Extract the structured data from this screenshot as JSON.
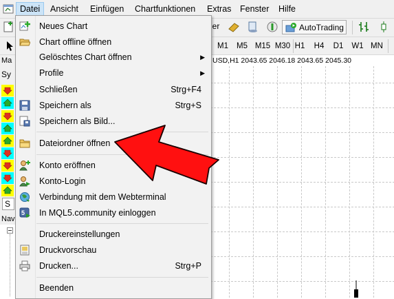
{
  "menubar": {
    "items": [
      "Datei",
      "Ansicht",
      "Einfügen",
      "Chartfunktionen",
      "Extras",
      "Fenster",
      "Hilfe"
    ]
  },
  "toolbar": {
    "autotrading_label": "AutoTrading"
  },
  "timeframes": [
    "M1",
    "M5",
    "M15",
    "M30",
    "H1",
    "H4",
    "D1",
    "W1",
    "MN"
  ],
  "left_panel": {
    "market_label": "Ma",
    "symbols_label": "Sy",
    "symbols_tab": "S",
    "navigator_label": "Nav"
  },
  "chart": {
    "title": "USD,H1  2043.65 2046.18 2043.65 2045.30"
  },
  "file_menu": {
    "items": [
      {
        "label": "Neues Chart",
        "shortcut": "",
        "submenu": false,
        "icon": "new-chart-icon"
      },
      {
        "label": "Chart offline öffnen",
        "shortcut": "",
        "submenu": false,
        "icon": "folder-open-icon"
      },
      {
        "label": "Gelöschtes Chart öffnen",
        "shortcut": "",
        "submenu": true,
        "icon": ""
      },
      {
        "label": "Profile",
        "shortcut": "",
        "submenu": true,
        "icon": ""
      },
      {
        "label": "Schließen",
        "shortcut": "Strg+F4",
        "submenu": false,
        "icon": ""
      },
      {
        "label": "Speichern als",
        "shortcut": "Strg+S",
        "submenu": false,
        "icon": "save-icon"
      },
      {
        "label": "Speichern als Bild...",
        "shortcut": "",
        "submenu": false,
        "icon": "save-image-icon"
      },
      {
        "label": "Dateiordner öffnen",
        "shortcut": "",
        "submenu": false,
        "icon": "folder-icon"
      },
      {
        "label": "Konto eröffnen",
        "shortcut": "",
        "submenu": false,
        "icon": "open-account-icon"
      },
      {
        "label": "Konto-Login",
        "shortcut": "",
        "submenu": false,
        "icon": "login-icon"
      },
      {
        "label": "Verbindung mit dem Webterminal",
        "shortcut": "",
        "submenu": false,
        "icon": "webterminal-icon"
      },
      {
        "label": "In MQL5.community einloggen",
        "shortcut": "",
        "submenu": false,
        "icon": "mql5-icon"
      },
      {
        "label": "Druckereinstellungen",
        "shortcut": "",
        "submenu": false,
        "icon": ""
      },
      {
        "label": "Druckvorschau",
        "shortcut": "",
        "submenu": false,
        "icon": "print-preview-icon"
      },
      {
        "label": "Drucken...",
        "shortcut": "Strg+P",
        "submenu": false,
        "icon": "printer-icon"
      },
      {
        "label": "Beenden",
        "shortcut": "",
        "submenu": false,
        "icon": ""
      }
    ]
  },
  "colors": {
    "menu_highlight": "#cce4f7",
    "arrow_red": "#ff0000",
    "arrow_up_bg": "#ffff00",
    "arrow_down_bg": "#00ffff"
  }
}
